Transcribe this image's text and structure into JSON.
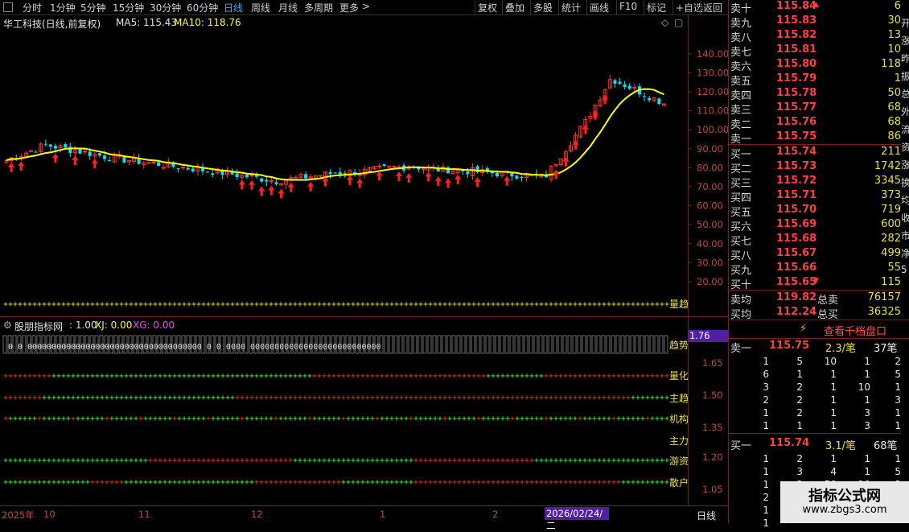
{
  "toolbar": {
    "left_items": [
      "分时",
      "1分钟",
      "5分钟",
      "15分钟",
      "30分钟",
      "60分钟",
      "日线",
      "周线",
      "月线",
      "多周期",
      "更多"
    ],
    "active": "日线",
    "more_arrow": ">",
    "right_items": [
      "复权",
      "叠加",
      "多股",
      "统计",
      "画线",
      "F10",
      "标记",
      "+自选",
      "返回"
    ]
  },
  "main_chart": {
    "title": "华工科技(日线,前复权)",
    "ma5_label": "MA5: 115.43",
    "ma10_label": "MA10: 118.76",
    "price_ticks": [
      "140.00",
      "130.00",
      "120.00",
      "110.00",
      "100.00",
      "90.00",
      "80.00",
      "70.00",
      "60.00",
      "50.00",
      "40.00",
      "30.00",
      "20.00"
    ],
    "band_label": "量趋",
    "up_color": "#ff3232",
    "down_color": "#00e5ff",
    "ma_color": "#ffff00"
  },
  "indicator": {
    "title": "股朋指标网",
    "v1": ": 1.00",
    "xj": "XJ: 0.00",
    "xg": "XG: 0.00",
    "highlight_value": "1.76",
    "ticks": [
      "1.65",
      "1.50",
      "1.35",
      "1.20",
      "1.05"
    ],
    "row_labels": [
      "趋势",
      "量化",
      "主趋",
      "机构",
      "主力",
      "游资",
      "散户"
    ]
  },
  "xaxis": {
    "labels": [
      "2025年",
      "10",
      "11",
      "12",
      "1",
      "2"
    ],
    "cursor_date": "2026/02/24/二",
    "period": "日线"
  },
  "order_book": {
    "asks": [
      {
        "label": "卖十",
        "price": "115.84",
        "vol": "6"
      },
      {
        "label": "卖九",
        "price": "115.83",
        "vol": "30"
      },
      {
        "label": "卖八",
        "price": "115.82",
        "vol": "13"
      },
      {
        "label": "卖七",
        "price": "115.81",
        "vol": "10"
      },
      {
        "label": "卖六",
        "price": "115.80",
        "vol": "118"
      },
      {
        "label": "卖五",
        "price": "115.79",
        "vol": "1"
      },
      {
        "label": "卖四",
        "price": "115.78",
        "vol": "50"
      },
      {
        "label": "卖三",
        "price": "115.77",
        "vol": "68"
      },
      {
        "label": "卖二",
        "price": "115.76",
        "vol": "68"
      },
      {
        "label": "卖一",
        "price": "115.75",
        "vol": "86"
      }
    ],
    "bids": [
      {
        "label": "买一",
        "price": "115.74",
        "vol": "211"
      },
      {
        "label": "买二",
        "price": "115.73",
        "vol": "1742"
      },
      {
        "label": "买三",
        "price": "115.72",
        "vol": "3345"
      },
      {
        "label": "买四",
        "price": "115.71",
        "vol": "373"
      },
      {
        "label": "买五",
        "price": "115.70",
        "vol": "719"
      },
      {
        "label": "买六",
        "price": "115.69",
        "vol": "600"
      },
      {
        "label": "买七",
        "price": "115.68",
        "vol": "282"
      },
      {
        "label": "买八",
        "price": "115.67",
        "vol": "499"
      },
      {
        "label": "买九",
        "price": "115.66",
        "vol": "55"
      },
      {
        "label": "买十",
        "price": "115.65",
        "vol": "115"
      }
    ],
    "avg_ask_label": "卖均",
    "avg_ask": "119.82",
    "total_ask_label": "总卖",
    "total_ask": "76157",
    "avg_bid_label": "买均",
    "avg_bid": "112.24",
    "total_bid_label": "总买",
    "total_bid": "36325",
    "strip_chars": [
      "开",
      "涨",
      "昨",
      "振",
      "总",
      "外",
      "流",
      "资",
      "涨",
      "换",
      "均",
      "收",
      "市",
      "净",
      "5"
    ]
  },
  "level2": {
    "button": "查看千档盘口",
    "ask1": {
      "label": "卖一",
      "price": "115.75",
      "per": "2.3/笔",
      "count": "37笔"
    },
    "ask_grid": [
      [
        "1",
        "5",
        "10",
        "1",
        "2"
      ],
      [
        "6",
        "1",
        "1",
        "1",
        "5"
      ],
      [
        "3",
        "2",
        "1",
        "10",
        "1"
      ],
      [
        "2",
        "2",
        "1",
        "1",
        "3"
      ],
      [
        "1",
        "2",
        "1",
        "3",
        "1"
      ],
      [
        "1",
        "1",
        "1",
        "3",
        "1"
      ]
    ],
    "bid1": {
      "label": "买一",
      "price": "115.74",
      "per": "3.1/笔",
      "count": "68笔"
    },
    "bid_grid": [
      [
        "1",
        "2",
        "1",
        "1",
        "1"
      ],
      [
        "1",
        "3",
        "4",
        "1",
        "5"
      ],
      [
        "1",
        "2",
        "50",
        "10",
        "3"
      ],
      [
        "2",
        "",
        "",
        "",
        ""
      ],
      [
        "1",
        "",
        "",
        "",
        ""
      ],
      [
        "1",
        "",
        "",
        "",
        ""
      ]
    ]
  },
  "watermark": {
    "line1": "指标公式网",
    "line2": "www.zbgs3.com"
  }
}
